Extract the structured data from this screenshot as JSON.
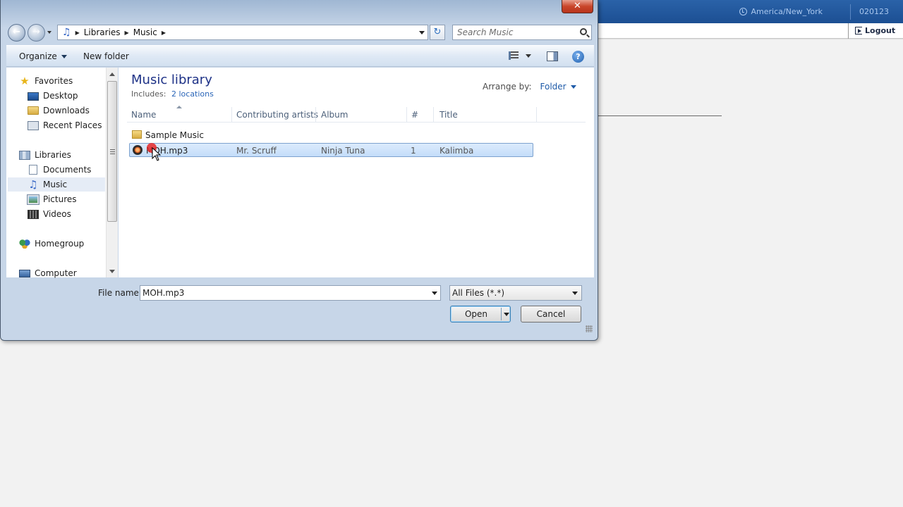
{
  "app": {
    "timezone": "America/New_York",
    "account_id": "020123",
    "logout_label": "Logout"
  },
  "dialog": {
    "close_label": "✕",
    "address": {
      "crumbs": [
        "Libraries",
        "Music"
      ]
    },
    "search": {
      "placeholder": "Search Music"
    },
    "toolbar": {
      "organize_label": "Organize",
      "new_folder_label": "New folder"
    },
    "nav": {
      "items": [
        {
          "label": "Favorites",
          "icon": "star-icon"
        },
        {
          "label": "Desktop",
          "icon": "desktop-icon"
        },
        {
          "label": "Downloads",
          "icon": "downloads-folder-icon"
        },
        {
          "label": "Recent Places",
          "icon": "recent-places-icon"
        },
        {
          "label": "Libraries",
          "icon": "libraries-icon"
        },
        {
          "label": "Documents",
          "icon": "documents-icon"
        },
        {
          "label": "Music",
          "icon": "music-note-icon",
          "selected": true
        },
        {
          "label": "Pictures",
          "icon": "pictures-icon"
        },
        {
          "label": "Videos",
          "icon": "videos-icon"
        },
        {
          "label": "Homegroup",
          "icon": "homegroup-icon"
        },
        {
          "label": "Computer",
          "icon": "computer-icon"
        }
      ]
    },
    "library": {
      "title": "Music library",
      "includes_label": "Includes:",
      "includes_link": "2 locations",
      "arrange_label": "Arrange by:",
      "arrange_value": "Folder"
    },
    "columns": [
      "Name",
      "Contributing artists",
      "Album",
      "#",
      "Title"
    ],
    "rows": [
      {
        "name": "Sample Music",
        "artist": "",
        "album": "",
        "track": "",
        "title": "",
        "type": "folder"
      },
      {
        "name": "MOH.mp3",
        "artist": "Mr. Scruff",
        "album": "Ninja Tuna",
        "track": "1",
        "title": "Kalimba",
        "type": "media",
        "selected": true
      }
    ],
    "file_name_label": "File name:",
    "file_name_value": "MOH.mp3",
    "file_type_value": "All Files (*.*)",
    "open_label": "Open",
    "cancel_label": "Cancel"
  }
}
